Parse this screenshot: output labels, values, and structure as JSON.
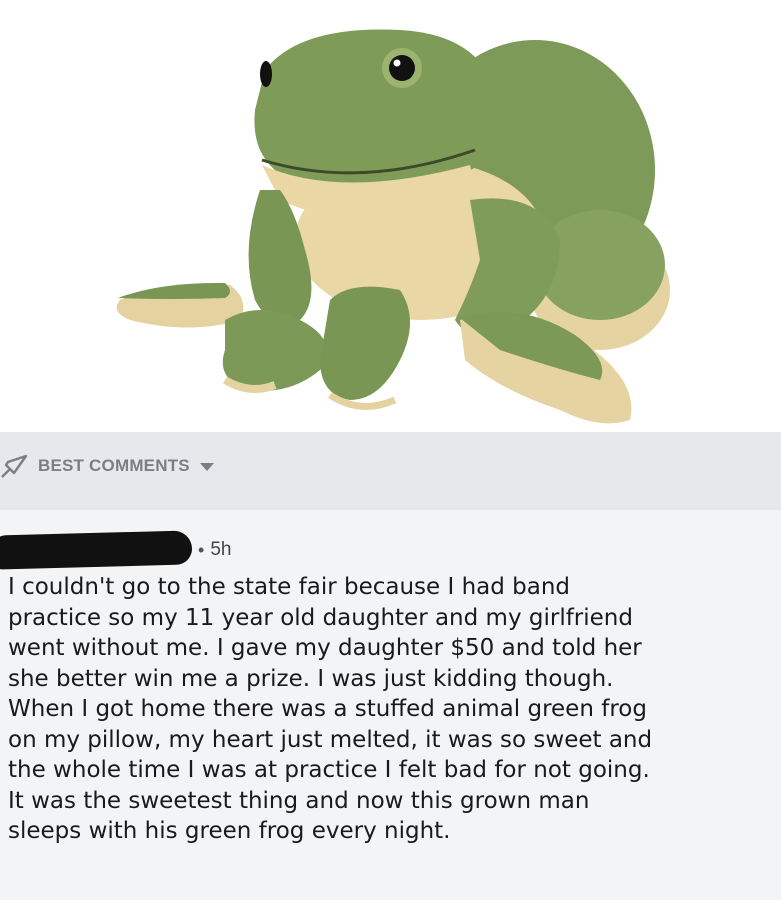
{
  "post_image": {
    "subject": "frog-plush"
  },
  "comments_bar": {
    "label": "BEST COMMENTS",
    "icon": "rocket-icon",
    "dropdown_icon": "caret-down-icon",
    "background": "#e6e8eb",
    "text_color": "#7b7f85"
  },
  "comment": {
    "author_redacted": true,
    "separator": "•",
    "timestamp": "5h",
    "lines": [
      "I couldn't go to the state fair because I had band",
      "practice so my 11 year old daughter and my girlfriend",
      "went without me. I gave my daughter $50 and told her",
      "she better win me a prize. I was just kidding though.",
      "When I got home there was a stuffed animal green frog",
      "on my pillow, my heart just melted, it was so sweet and",
      "the whole time I was at practice I felt bad for not going.",
      "It was the sweetest thing and now this grown man",
      "sleeps with his green frog every night."
    ]
  }
}
